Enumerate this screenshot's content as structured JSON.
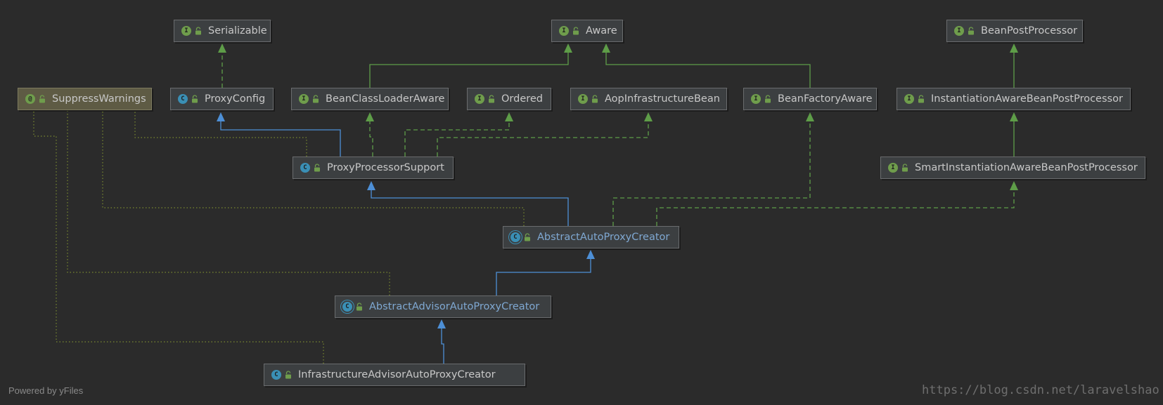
{
  "nodes": [
    {
      "id": "Serializable",
      "label": "Serializable",
      "kind": "interface",
      "icon": "I"
    },
    {
      "id": "Aware",
      "label": "Aware",
      "kind": "interface",
      "icon": "I"
    },
    {
      "id": "BeanPostProcessor",
      "label": "BeanPostProcessor",
      "kind": "interface",
      "icon": "I"
    },
    {
      "id": "SuppressWarnings",
      "label": "SuppressWarnings",
      "kind": "annotation",
      "icon": "@"
    },
    {
      "id": "ProxyConfig",
      "label": "ProxyConfig",
      "kind": "class",
      "icon": "C"
    },
    {
      "id": "BeanClassLoaderAware",
      "label": "BeanClassLoaderAware",
      "kind": "interface",
      "icon": "I"
    },
    {
      "id": "Ordered",
      "label": "Ordered",
      "kind": "interface",
      "icon": "I"
    },
    {
      "id": "AopInfrastructureBean",
      "label": "AopInfrastructureBean",
      "kind": "interface",
      "icon": "I"
    },
    {
      "id": "BeanFactoryAware",
      "label": "BeanFactoryAware",
      "kind": "interface",
      "icon": "I"
    },
    {
      "id": "InstantiationAwareBeanPostProcessor",
      "label": "InstantiationAwareBeanPostProcessor",
      "kind": "interface",
      "icon": "I"
    },
    {
      "id": "ProxyProcessorSupport",
      "label": "ProxyProcessorSupport",
      "kind": "class",
      "icon": "C"
    },
    {
      "id": "SmartInstantiationAwareBeanPostProcessor",
      "label": "SmartInstantiationAwareBeanPostProcessor",
      "kind": "interface",
      "icon": "I"
    },
    {
      "id": "AbstractAutoProxyCreator",
      "label": "AbstractAutoProxyCreator",
      "kind": "abstract",
      "icon": "C"
    },
    {
      "id": "AbstractAdvisorAutoProxyCreator",
      "label": "AbstractAdvisorAutoProxyCreator",
      "kind": "abstract",
      "icon": "C"
    },
    {
      "id": "InfrastructureAdvisorAutoProxyCreator",
      "label": "InfrastructureAdvisorAutoProxyCreator",
      "kind": "class",
      "icon": "C"
    }
  ],
  "edges": [
    {
      "from": "ProxyConfig",
      "to": "Serializable",
      "type": "implements"
    },
    {
      "from": "BeanClassLoaderAware",
      "to": "Aware",
      "type": "extends-interface"
    },
    {
      "from": "BeanFactoryAware",
      "to": "Aware",
      "type": "extends-interface"
    },
    {
      "from": "InstantiationAwareBeanPostProcessor",
      "to": "BeanPostProcessor",
      "type": "extends-interface"
    },
    {
      "from": "SmartInstantiationAwareBeanPostProcessor",
      "to": "InstantiationAwareBeanPostProcessor",
      "type": "extends-interface"
    },
    {
      "from": "ProxyProcessorSupport",
      "to": "ProxyConfig",
      "type": "extends"
    },
    {
      "from": "ProxyProcessorSupport",
      "to": "BeanClassLoaderAware",
      "type": "implements"
    },
    {
      "from": "ProxyProcessorSupport",
      "to": "Ordered",
      "type": "implements"
    },
    {
      "from": "ProxyProcessorSupport",
      "to": "AopInfrastructureBean",
      "type": "implements"
    },
    {
      "from": "AbstractAutoProxyCreator",
      "to": "ProxyProcessorSupport",
      "type": "extends"
    },
    {
      "from": "AbstractAutoProxyCreator",
      "to": "BeanFactoryAware",
      "type": "implements"
    },
    {
      "from": "AbstractAutoProxyCreator",
      "to": "SmartInstantiationAwareBeanPostProcessor",
      "type": "implements"
    },
    {
      "from": "AbstractAdvisorAutoProxyCreator",
      "to": "AbstractAutoProxyCreator",
      "type": "extends"
    },
    {
      "from": "InfrastructureAdvisorAutoProxyCreator",
      "to": "AbstractAdvisorAutoProxyCreator",
      "type": "extends"
    },
    {
      "from": "ProxyProcessorSupport",
      "to": "SuppressWarnings",
      "type": "annotated"
    },
    {
      "from": "AbstractAutoProxyCreator",
      "to": "SuppressWarnings",
      "type": "annotated"
    },
    {
      "from": "AbstractAdvisorAutoProxyCreator",
      "to": "SuppressWarnings",
      "type": "annotated"
    },
    {
      "from": "InfrastructureAdvisorAutoProxyCreator",
      "to": "SuppressWarnings",
      "type": "annotated"
    }
  ],
  "colors": {
    "background": "#2b2b2b",
    "extends": "#4d8fd6",
    "implements": "#5e9d48",
    "annotated": "#7a8a30"
  },
  "footer": {
    "powered_by": "Powered by yFiles"
  },
  "watermark": {
    "text": "https://blog.csdn.net/laravelshao"
  }
}
